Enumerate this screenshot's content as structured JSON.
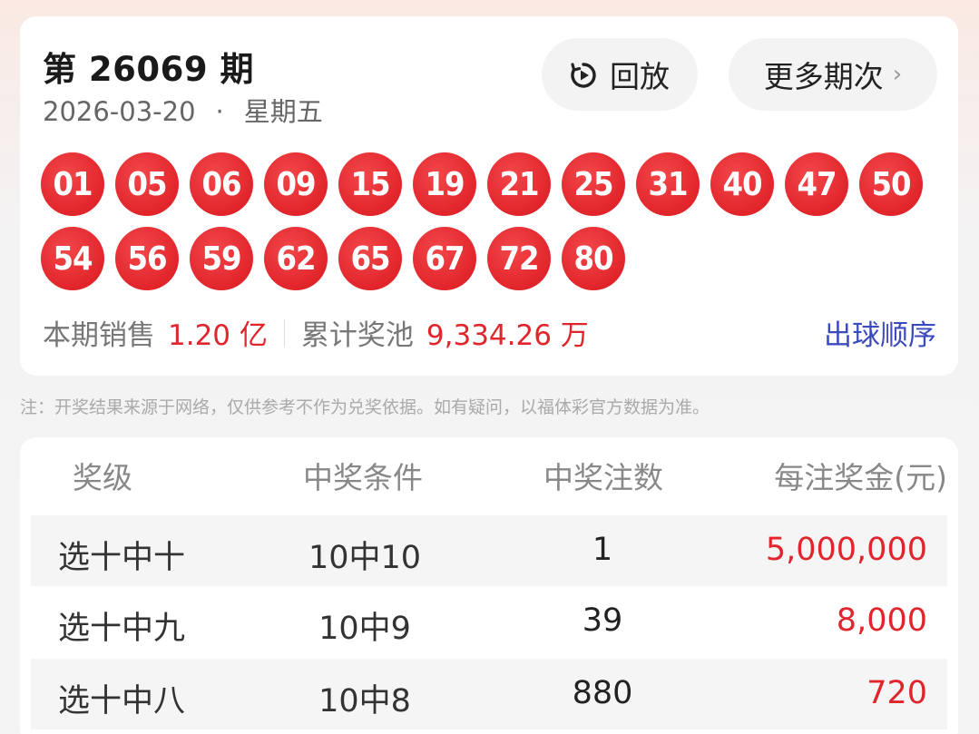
{
  "header": {
    "issue": "第 26069 期",
    "date": "2026-03-20",
    "dot": "·",
    "weekday": "星期五",
    "replay_label": "回放",
    "more_label": "更多期次",
    "more_chevron": "›"
  },
  "balls": [
    "01",
    "05",
    "06",
    "09",
    "15",
    "19",
    "21",
    "25",
    "31",
    "40",
    "47",
    "50",
    "54",
    "56",
    "59",
    "62",
    "65",
    "67",
    "72",
    "80"
  ],
  "stats": {
    "sales_label": "本期销售",
    "sales_value": "1.20 亿",
    "pool_label": "累计奖池",
    "pool_value": "9,334.26 万",
    "order_link": "出球顺序"
  },
  "note": "注：开奖结果来源于网络，仅供参考不作为兑奖依据。如有疑问，以福体彩官方数据为准。",
  "table": {
    "headers": [
      "奖级",
      "中奖条件",
      "中奖注数",
      "每注奖金(元)"
    ],
    "rows": [
      {
        "level": "选十中十",
        "condition": "10中10",
        "count": "1",
        "prize": "5,000,000"
      },
      {
        "level": "选十中九",
        "condition": "10中9",
        "count": "39",
        "prize": "8,000"
      },
      {
        "level": "选十中八",
        "condition": "10中8",
        "count": "880",
        "prize": "720"
      }
    ]
  },
  "colors": {
    "ball_red": "#e1252b",
    "value_red": "#e0262c",
    "link_blue": "#3c4ac0"
  },
  "icons": {
    "replay": "replay-icon",
    "more": "chevron-right-icon"
  }
}
